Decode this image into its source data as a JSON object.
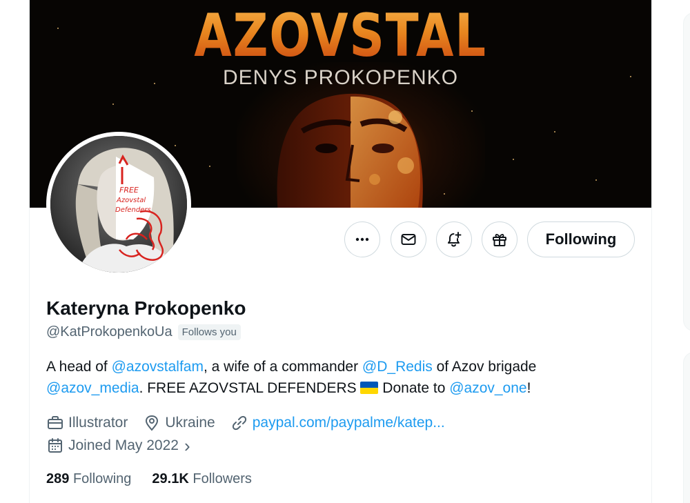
{
  "banner": {
    "title": "AZOVSTAL",
    "subtitle": "DENYS PROKOPENKO"
  },
  "avatar": {
    "drawn_text_lines": [
      "FREE",
      "Azovstal",
      "Defenders"
    ]
  },
  "actions": {
    "more_icon": "more-horizontal-icon",
    "message_icon": "envelope-icon",
    "notify_icon": "bell-plus-icon",
    "gift_icon": "gift-icon",
    "following_label": "Following"
  },
  "profile": {
    "name": "Kateryna Prokopenko",
    "handle": "@KatProkopenkoUa",
    "follows_you": "Follows you",
    "bio": {
      "t1": "A head of ",
      "m1": "@azovstalfam",
      "t2": ", a wife of a commander ",
      "m2": "@D_Redis",
      "t3": " of Azov brigade ",
      "m3": "@azov_media",
      "t4": ". FREE AZOVSTAL DEFENDERS ",
      "t5": " Donate to ",
      "m4": "@azov_one",
      "t6": "!"
    },
    "profession": "Illustrator",
    "location": "Ukraine",
    "website": "paypal.com/paypalme/katep...",
    "joined": "Joined May 2022",
    "joined_chevron": "›"
  },
  "stats": {
    "following_count": "289",
    "following_label": "Following",
    "followers_count": "29.1K",
    "followers_label": "Followers"
  },
  "colors": {
    "accent": "#1d9bf0",
    "text": "#0f1419",
    "secondary": "#536471",
    "border": "#cfd9de"
  }
}
